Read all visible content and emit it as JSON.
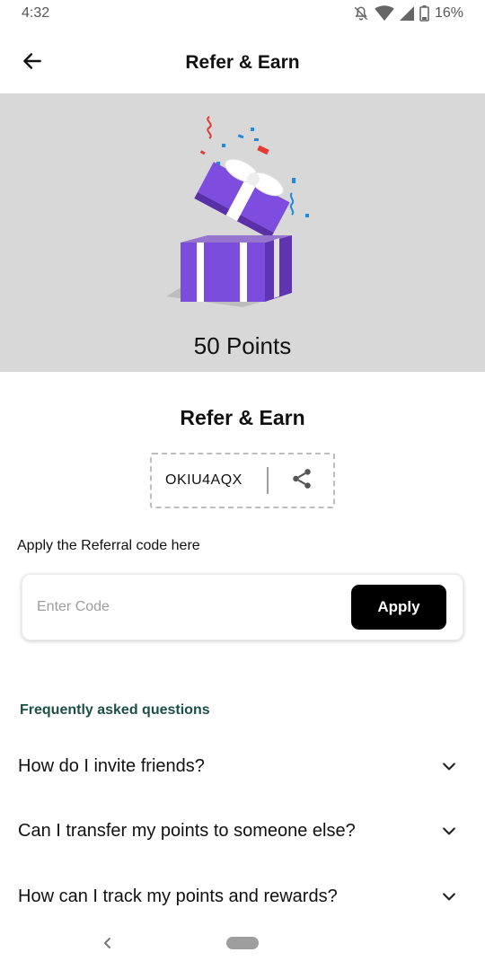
{
  "status_bar": {
    "time": "4:32",
    "battery": "16%",
    "icons": [
      "mute-icon",
      "wifi-icon",
      "signal-icon",
      "battery-icon"
    ]
  },
  "app_bar": {
    "title": "Refer & Earn",
    "back_icon": "arrow-left-icon"
  },
  "hero": {
    "points_label": "50 Points",
    "illustration": "gift-box-illustration"
  },
  "referral": {
    "title": "Refer & Earn",
    "code": "OKIU4AQX",
    "share_icon": "share-icon"
  },
  "apply": {
    "label": "Apply the Referral code here",
    "placeholder": "Enter Code",
    "value": "",
    "button_label": "Apply"
  },
  "faq": {
    "heading": "Frequently asked questions",
    "items": [
      {
        "question": "How do I invite friends?"
      },
      {
        "question": "Can I transfer my points to someone else?"
      },
      {
        "question": "How can I track my points and rewards?"
      }
    ]
  },
  "colors": {
    "hero_bg": "#d8d8d8",
    "accent_purple": "#6a3fc4",
    "faq_heading": "#1b5048",
    "button_bg": "#000000"
  }
}
